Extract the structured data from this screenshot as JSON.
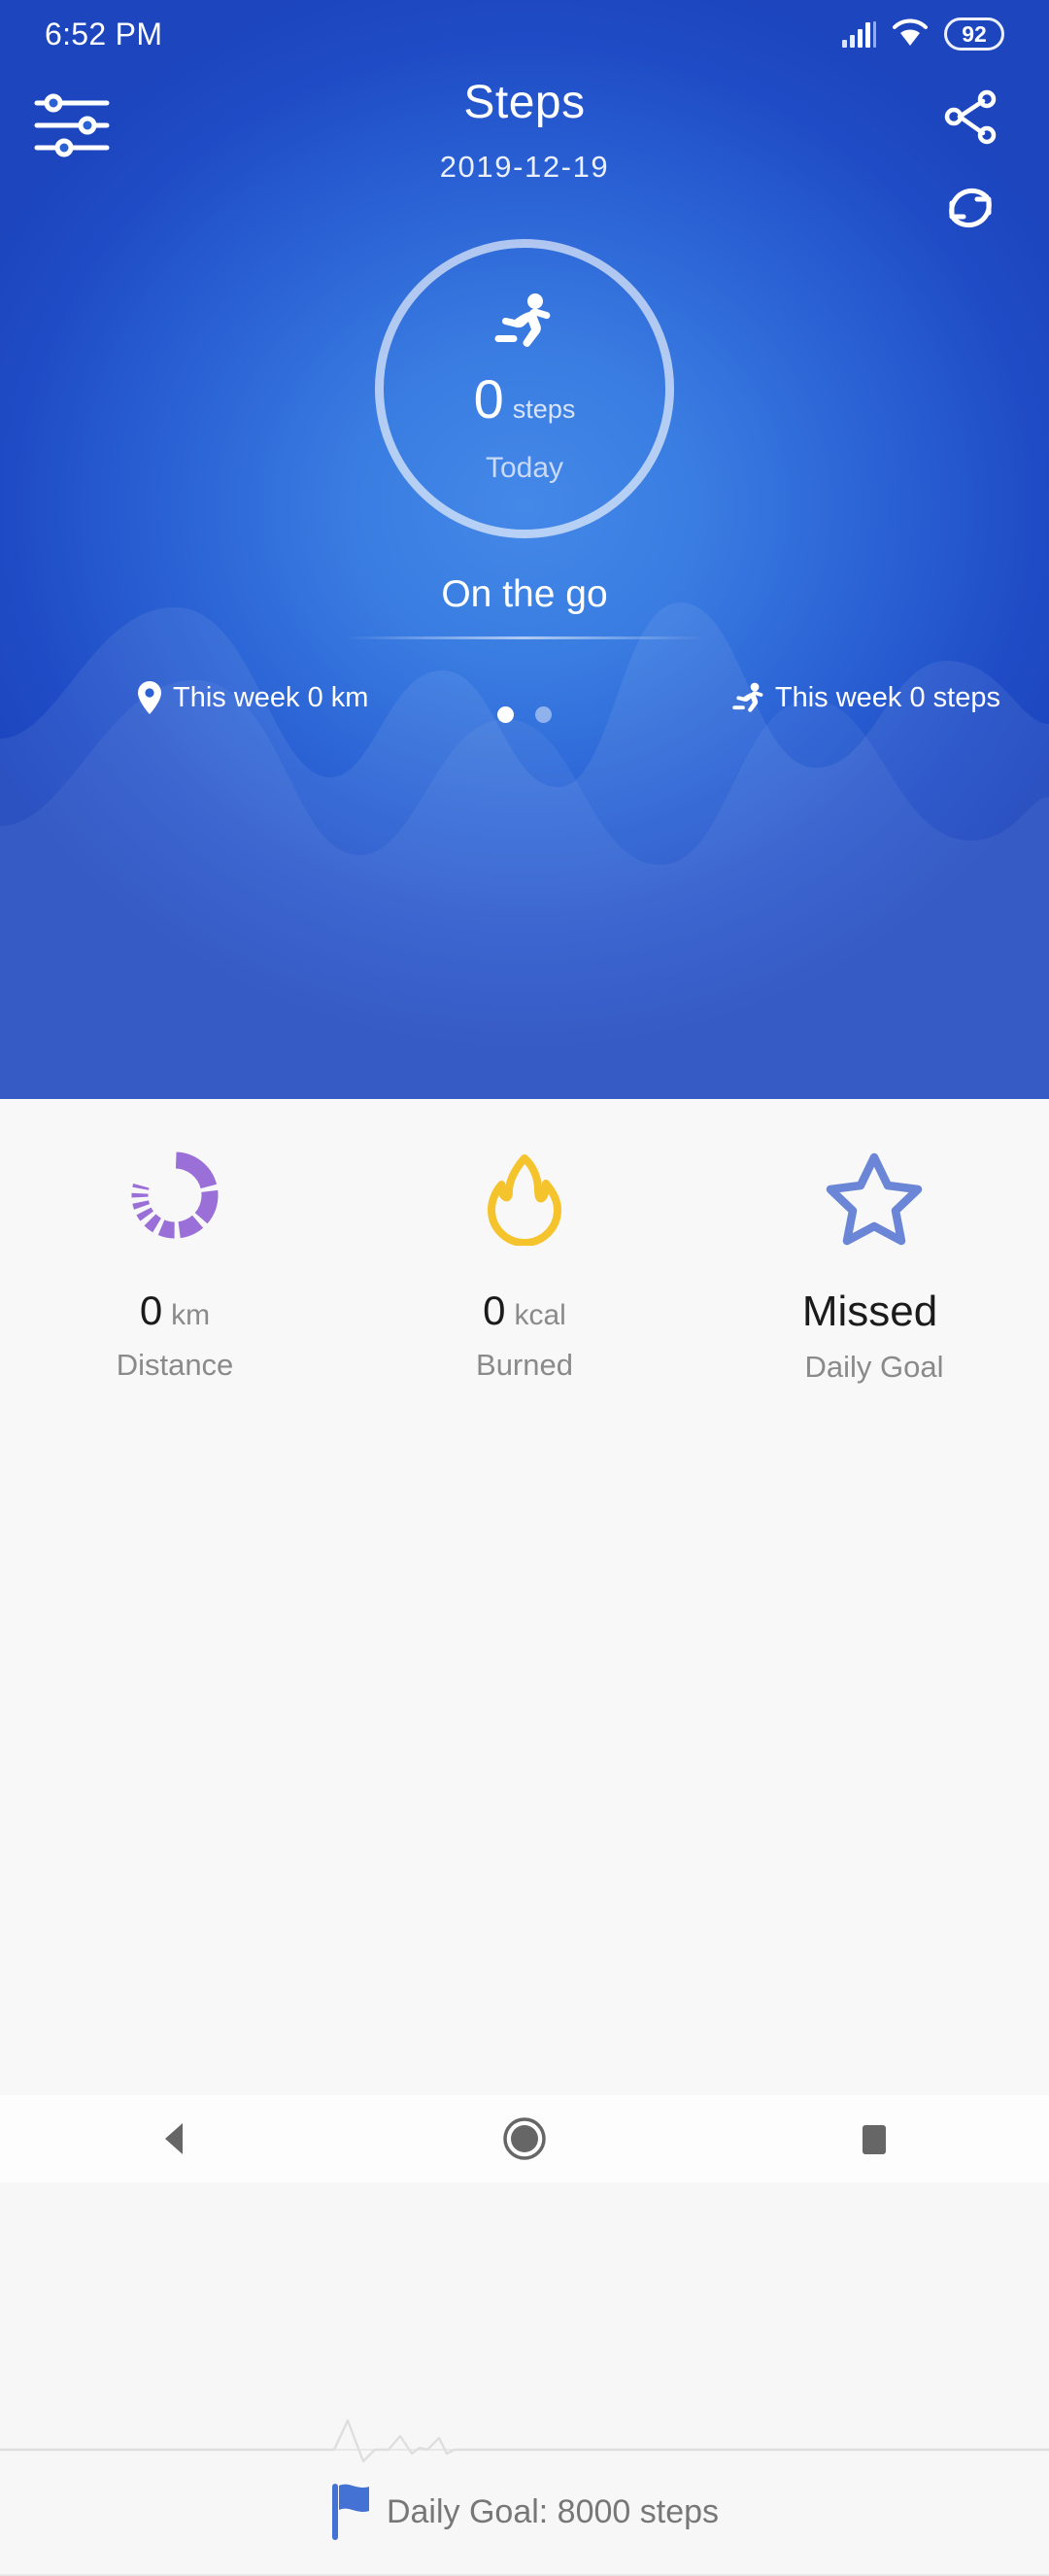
{
  "status_bar": {
    "time": "6:52 PM",
    "signal_icon": "signal-bars-icon",
    "wifi_icon": "wifi-icon",
    "battery_level": "92"
  },
  "app_bar": {
    "title": "Steps",
    "date": "2019-12-19",
    "settings_icon": "sliders-settings-icon",
    "share_icon": "share-icon",
    "sync_icon": "sync-refresh-icon"
  },
  "progress": {
    "runner_icon": "running-person-icon",
    "value": "0",
    "unit": "steps",
    "period": "Today",
    "percent": 0
  },
  "status": {
    "label": "On the go"
  },
  "week": {
    "distance_icon": "location-pin-icon",
    "distance_text": "This week 0 km",
    "steps_icon": "running-person-icon",
    "steps_text": "This week 0 steps"
  },
  "pager": {
    "total": 2,
    "active_index": 0
  },
  "stats": [
    {
      "icon": "dashed-ring-icon",
      "icon_color": "#9B6FD8",
      "value": "0",
      "unit": "km",
      "caption": "Distance"
    },
    {
      "icon": "flame-icon",
      "icon_color": "#F5C32C",
      "value": "0",
      "unit": "kcal",
      "caption": "Burned"
    },
    {
      "icon": "star-icon",
      "icon_color": "#6B86D6",
      "value": "Missed",
      "unit": "",
      "caption": "Daily Goal"
    }
  ],
  "footer": {
    "ecg_icon": "heartbeat-line-icon",
    "flag_icon": "flag-icon",
    "goal_text": "Daily Goal: 8000 steps"
  },
  "nav_bar": {
    "back_icon": "back-triangle-icon",
    "home_icon": "home-circle-icon",
    "recents_icon": "recents-square-icon"
  },
  "theme": {
    "hero_blue": "#2A61D4",
    "hero_dark": "#1C45BE",
    "sheet_bg": "#F8F8F8",
    "accent_flag": "#4471D4"
  }
}
